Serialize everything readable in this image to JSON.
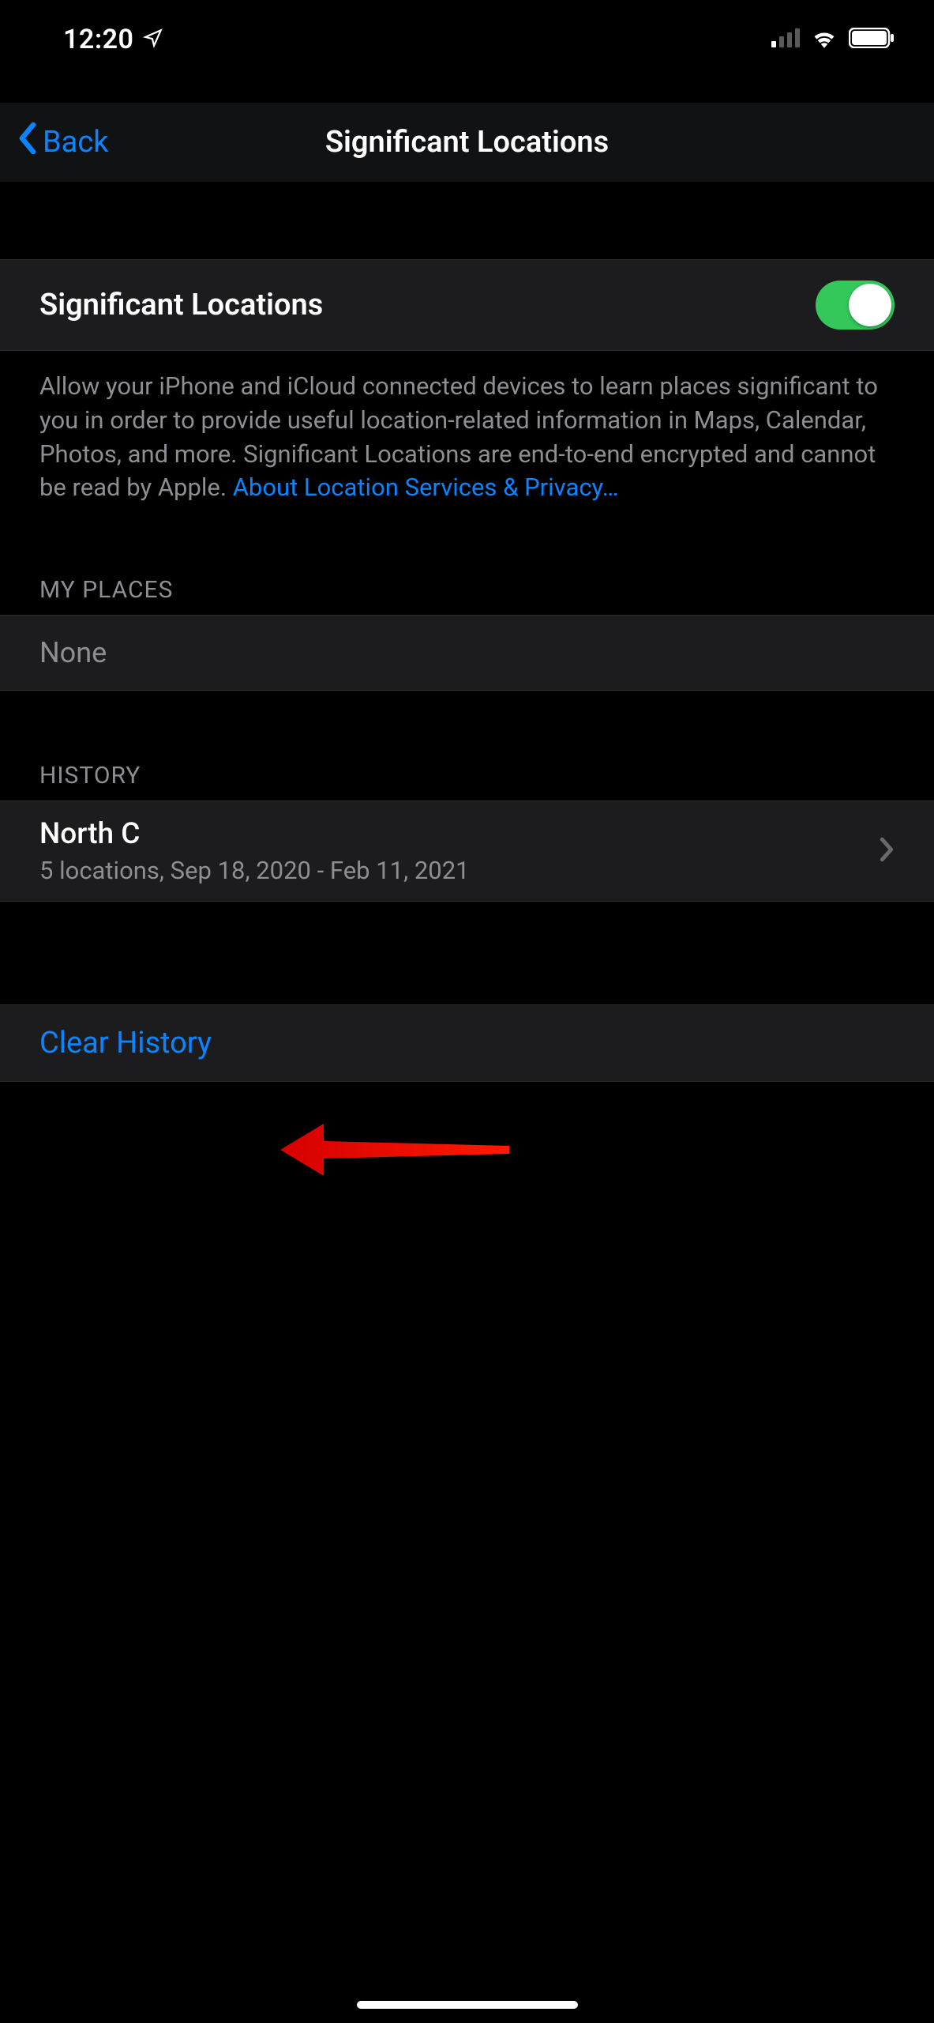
{
  "status": {
    "time": "12:20"
  },
  "nav": {
    "back_label": "Back",
    "title": "Significant Locations"
  },
  "toggle": {
    "label": "Significant Locations",
    "enabled": true
  },
  "footer": {
    "description": "Allow your iPhone and iCloud connected devices to learn places significant to you in order to provide useful location-related information in Maps, Calendar, Photos, and more. Significant Locations are end-to-end encrypted and cannot be read by Apple. ",
    "link_label": "About Location Services & Privacy…"
  },
  "my_places": {
    "header": "MY PLACES",
    "value": "None"
  },
  "history": {
    "header": "HISTORY",
    "items": [
      {
        "place": "North C",
        "detail": "5 locations, Sep 18, 2020 - Feb 11, 2021"
      }
    ]
  },
  "clear": {
    "label": "Clear History"
  },
  "colors": {
    "accent": "#0a84ff",
    "toggle_on": "#34c759"
  }
}
